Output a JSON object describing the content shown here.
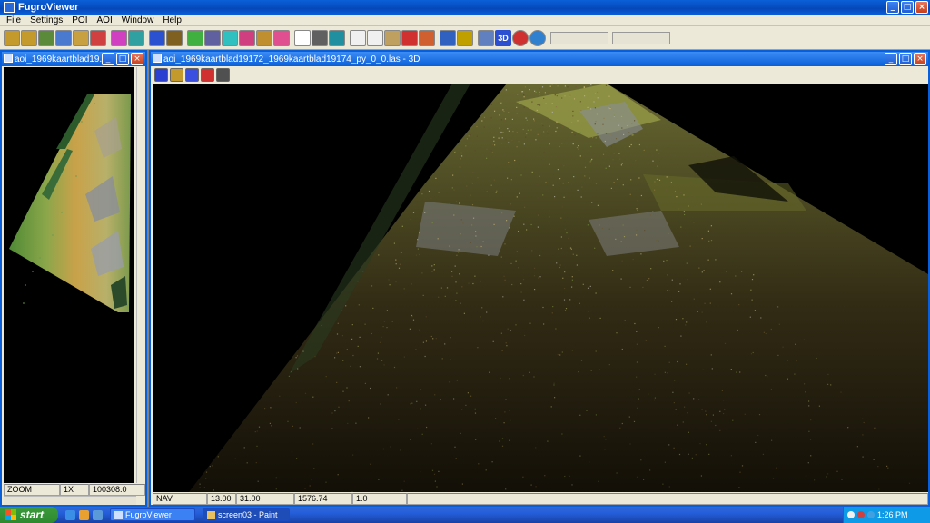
{
  "app": {
    "title": "FugroViewer",
    "window_buttons": [
      "_",
      "□",
      "×"
    ]
  },
  "menu": [
    "File",
    "Settings",
    "POI",
    "AOI",
    "Window",
    "Help"
  ],
  "toolbar": {
    "icons": [
      {
        "name": "open-folder-icon",
        "color": "#c49a2c"
      },
      {
        "name": "open-file-icon",
        "color": "#c49a2c"
      },
      {
        "name": "layer-add-icon",
        "color": "#5a8a3a"
      },
      {
        "name": "layer-edit-icon",
        "color": "#4a7ad0"
      },
      {
        "name": "palette-icon",
        "color": "#c8a040"
      },
      {
        "name": "grid-icon",
        "color": "#d04040"
      },
      {
        "name": "sep"
      },
      {
        "name": "color-wheel-icon",
        "color": "#d040c0"
      },
      {
        "name": "elevation-icon",
        "color": "#30a0a0"
      },
      {
        "name": "sep"
      },
      {
        "name": "profile-icon",
        "color": "#2b50d0"
      },
      {
        "name": "surface-icon",
        "color": "#806020"
      },
      {
        "name": "sep"
      },
      {
        "name": "rgb-points-icon",
        "color": "#40b040"
      },
      {
        "name": "line-icon",
        "color": "#6060a0"
      },
      {
        "name": "color-ramp-icon",
        "color": "#30c0c0"
      },
      {
        "name": "intensity-icon",
        "color": "#d04080"
      },
      {
        "name": "classification-icon",
        "color": "#c09030"
      },
      {
        "name": "rainbow-icon",
        "color": "#e05090"
      },
      {
        "name": "sep"
      },
      {
        "name": "points-icon",
        "color": "#ffffff"
      },
      {
        "name": "dots-grid-icon",
        "color": "#606060"
      },
      {
        "name": "tin-icon",
        "color": "#2090a0"
      },
      {
        "name": "sep"
      },
      {
        "name": "pan-hand-icon",
        "color": "#f0f0f0"
      },
      {
        "name": "zoom-icon",
        "color": "#f0f0f0"
      },
      {
        "name": "select-icon",
        "color": "#c0a060"
      },
      {
        "name": "poi-pin-icon",
        "color": "#d03030"
      },
      {
        "name": "measure-icon",
        "color": "#d06030"
      },
      {
        "name": "sep"
      },
      {
        "name": "help-icon",
        "color": "#3060c0"
      },
      {
        "name": "ruler-icon",
        "color": "#c0a000"
      },
      {
        "name": "sep"
      },
      {
        "name": "pencil-icon",
        "color": "#6080c0"
      }
    ],
    "threed_label": "3D",
    "stop_icon_color": "#d03030",
    "refresh_icon_color": "#3080d0"
  },
  "left_window": {
    "title": "aoi_1969kaartblad19...",
    "status": [
      {
        "label": "ZOOM"
      },
      {
        "label": "1X"
      },
      {
        "label": "100308.0"
      }
    ]
  },
  "right_window": {
    "title": "aoi_1969kaartblad19172_1969kaartblad19174_py_0_0.las - 3D",
    "subtoolbar": [
      {
        "name": "home-icon",
        "color": "#2b3fd0"
      },
      {
        "name": "export-icon",
        "color": "#c49a2c"
      },
      {
        "name": "arrow-down-icon",
        "color": "#3a4fe0"
      },
      {
        "name": "arrow-up-icon",
        "color": "#d03030"
      },
      {
        "name": "split-view-icon",
        "color": "#505050"
      }
    ],
    "status": [
      {
        "label": "NAV"
      },
      {
        "label": "13.00"
      },
      {
        "label": "31.00"
      },
      {
        "label": "1576.74"
      },
      {
        "label": "1.0"
      }
    ]
  },
  "taskbar": {
    "start_label": "start",
    "tasks": [
      {
        "label": "FugroViewer",
        "active": false
      },
      {
        "label": "screen03 - Paint",
        "active": true
      }
    ],
    "time": "1:26 PM"
  }
}
